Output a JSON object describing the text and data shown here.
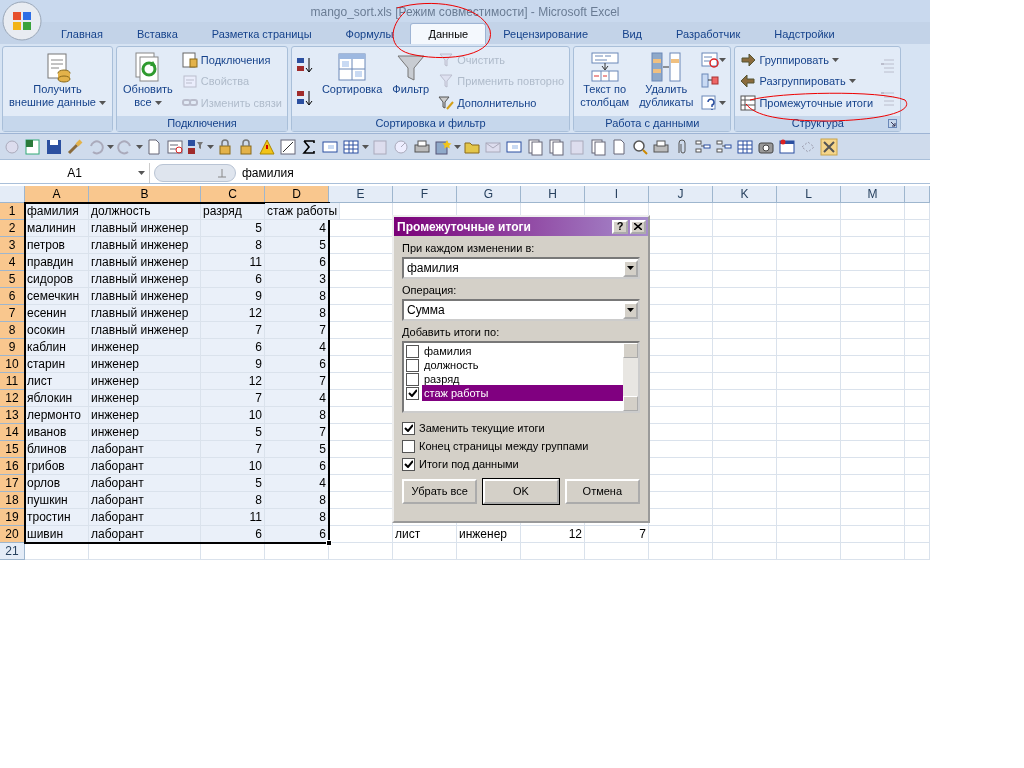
{
  "window": {
    "title": "mango_sort.xls  [Режим совместимости] - Microsoft Excel"
  },
  "tabs": [
    {
      "label": "Главная",
      "selected": false
    },
    {
      "label": "Вставка",
      "selected": false
    },
    {
      "label": "Разметка страницы",
      "selected": false
    },
    {
      "label": "Формулы",
      "selected": false
    },
    {
      "label": "Данные",
      "selected": true
    },
    {
      "label": "Рецензирование",
      "selected": false
    },
    {
      "label": "Вид",
      "selected": false
    },
    {
      "label": "Разработчик",
      "selected": false
    },
    {
      "label": "Надстройки",
      "selected": false
    }
  ],
  "ribbon": [
    {
      "columns": [
        [
          {
            "kind": "large",
            "label": "Получить\nвнешние данные",
            "dropdown": true,
            "disabled": false
          }
        ]
      ]
    },
    {
      "label": "Подключения",
      "columns": [
        [
          {
            "kind": "large",
            "label": "Обновить\nвсе",
            "dropdown": true,
            "disabled": false
          }
        ],
        [
          {
            "kind": "small",
            "label": "Подключения",
            "dropdown": false,
            "disabled": false
          },
          {
            "kind": "small",
            "label": "Свойства",
            "dropdown": false,
            "disabled": true
          },
          {
            "kind": "small",
            "label": "Изменить связи",
            "dropdown": false,
            "disabled": true
          }
        ]
      ]
    },
    {
      "label": "Сортировка и фильтр",
      "columns": [
        [
          {
            "kind": "icon",
            "dropdown": false,
            "disabled": false
          },
          {
            "kind": "icon",
            "dropdown": false,
            "disabled": false
          }
        ],
        [
          {
            "kind": "large",
            "label": "Сортировка",
            "dropdown": false,
            "disabled": false
          }
        ],
        [
          {
            "kind": "large",
            "label": "Фильтр",
            "dropdown": false,
            "disabled": false
          }
        ],
        [
          {
            "kind": "small",
            "label": "Очистить",
            "dropdown": false,
            "disabled": true
          },
          {
            "kind": "small",
            "label": "Применить повторно",
            "dropdown": false,
            "disabled": true
          },
          {
            "kind": "small",
            "label": "Дополнительно",
            "dropdown": false,
            "disabled": false
          }
        ]
      ]
    },
    {
      "label": "Работа с данными",
      "columns": [
        [
          {
            "kind": "large",
            "label": "Текст по\nстолбцам",
            "dropdown": false,
            "disabled": false
          }
        ],
        [
          {
            "kind": "large",
            "label": "Удалить\nдубликаты",
            "dropdown": false,
            "disabled": false
          }
        ],
        [
          {
            "kind": "icon",
            "dropdown": true,
            "disabled": false
          },
          {
            "kind": "icon",
            "dropdown": false,
            "disabled": false
          },
          {
            "kind": "icon",
            "dropdown": true,
            "disabled": false
          }
        ]
      ]
    },
    {
      "label": "Структура",
      "launcher": true,
      "columns": [
        [
          {
            "kind": "small",
            "label": "Группировать",
            "dropdown": true,
            "disabled": false
          },
          {
            "kind": "small",
            "label": "Разгруппировать",
            "dropdown": true,
            "disabled": false
          },
          {
            "kind": "small",
            "label": "Промежуточные итоги",
            "dropdown": false,
            "disabled": false
          }
        ],
        [
          {
            "kind": "icon",
            "dropdown": false,
            "disabled": true
          },
          {
            "kind": "icon",
            "dropdown": false,
            "disabled": true
          }
        ]
      ]
    }
  ],
  "formula_bar": {
    "name_box": "A1",
    "formula": "фамилия"
  },
  "columns": [
    {
      "label": "A",
      "selected": true
    },
    {
      "label": "B",
      "selected": true
    },
    {
      "label": "C",
      "selected": true
    },
    {
      "label": "D",
      "selected": true
    },
    {
      "label": "E",
      "selected": false
    },
    {
      "label": "F",
      "selected": false
    },
    {
      "label": "G",
      "selected": false
    },
    {
      "label": "H",
      "selected": false
    },
    {
      "label": "I",
      "selected": false
    },
    {
      "label": "J",
      "selected": false
    },
    {
      "label": "K",
      "selected": false
    },
    {
      "label": "L",
      "selected": false
    },
    {
      "label": "M",
      "selected": false
    }
  ],
  "rows": [
    {
      "header": "1",
      "selected": true,
      "cells": [
        "фамилия",
        "должность",
        "разряд",
        "стаж работы"
      ]
    },
    {
      "header": "2",
      "selected": true,
      "cells": [
        "малинин",
        "главный инженер",
        "5",
        "4"
      ]
    },
    {
      "header": "3",
      "selected": true,
      "cells": [
        "петров",
        "главный инженер",
        "8",
        "5"
      ]
    },
    {
      "header": "4",
      "selected": true,
      "cells": [
        "правдин",
        "главный инженер",
        "11",
        "6"
      ]
    },
    {
      "header": "5",
      "selected": true,
      "cells": [
        "сидоров",
        "главный инженер",
        "6",
        "3"
      ]
    },
    {
      "header": "6",
      "selected": true,
      "cells": [
        "семечкин",
        "главный инженер",
        "9",
        "8"
      ]
    },
    {
      "header": "7",
      "selected": true,
      "cells": [
        "есенин",
        "главный инженер",
        "12",
        "8"
      ]
    },
    {
      "header": "8",
      "selected": true,
      "cells": [
        "осокин",
        "главный инженер",
        "7",
        "7"
      ]
    },
    {
      "header": "9",
      "selected": true,
      "cells": [
        "каблин",
        "инженер",
        "6",
        "4"
      ]
    },
    {
      "header": "10",
      "selected": true,
      "cells": [
        "старин",
        "инженер",
        "9",
        "6"
      ]
    },
    {
      "header": "11",
      "selected": true,
      "cells": [
        "лист",
        "инженер",
        "12",
        "7"
      ]
    },
    {
      "header": "12",
      "selected": true,
      "cells": [
        "яблокин",
        "инженер",
        "7",
        "4"
      ]
    },
    {
      "header": "13",
      "selected": true,
      "cells": [
        "лермонто",
        "инженер",
        "10",
        "8"
      ]
    },
    {
      "header": "14",
      "selected": true,
      "cells": [
        "иванов",
        "инженер",
        "5",
        "7"
      ]
    },
    {
      "header": "15",
      "selected": true,
      "cells": [
        "блинов",
        "лаборант",
        "7",
        "5"
      ]
    },
    {
      "header": "16",
      "selected": true,
      "cells": [
        "грибов",
        "лаборант",
        "10",
        "6"
      ]
    },
    {
      "header": "17",
      "selected": true,
      "cells": [
        "орлов",
        "лаборант",
        "5",
        "4"
      ]
    },
    {
      "header": "18",
      "selected": true,
      "cells": [
        "пушкин",
        "лаборант",
        "8",
        "8"
      ]
    },
    {
      "header": "19",
      "selected": true,
      "cells": [
        "тростин",
        "лаборант",
        "11",
        "8"
      ]
    },
    {
      "header": "20",
      "selected": true,
      "cells": [
        "шивин",
        "лаборант",
        "6",
        "6"
      ],
      "cells_f_to_i": [
        "лист",
        "инженер",
        "12",
        "7"
      ]
    },
    {
      "header": "21",
      "selected": false,
      "cells": []
    }
  ],
  "dialog": {
    "title": "Промежуточные итоги",
    "help": "?",
    "group_by_label": "При каждом изменении в:",
    "group_by": "фамилия",
    "operation_label": "Операция:",
    "operation": "Сумма",
    "add_to_label": "Добавить итоги по:",
    "add_to": [
      {
        "label": "фамилия",
        "checked": false,
        "selected": false
      },
      {
        "label": "должность",
        "checked": false,
        "selected": false
      },
      {
        "label": "разряд",
        "checked": false,
        "selected": false
      },
      {
        "label": "стаж работы",
        "checked": true,
        "selected": true
      }
    ],
    "options": [
      {
        "label": "Заменить текущие итоги",
        "checked": true
      },
      {
        "label": "Конец страницы между группами",
        "checked": false
      },
      {
        "label": "Итоги под данными",
        "checked": true
      }
    ],
    "buttons": [
      {
        "label": "Убрать все",
        "default": false
      },
      {
        "label": "OK",
        "default": true
      },
      {
        "label": "Отмена",
        "default": false
      }
    ]
  }
}
